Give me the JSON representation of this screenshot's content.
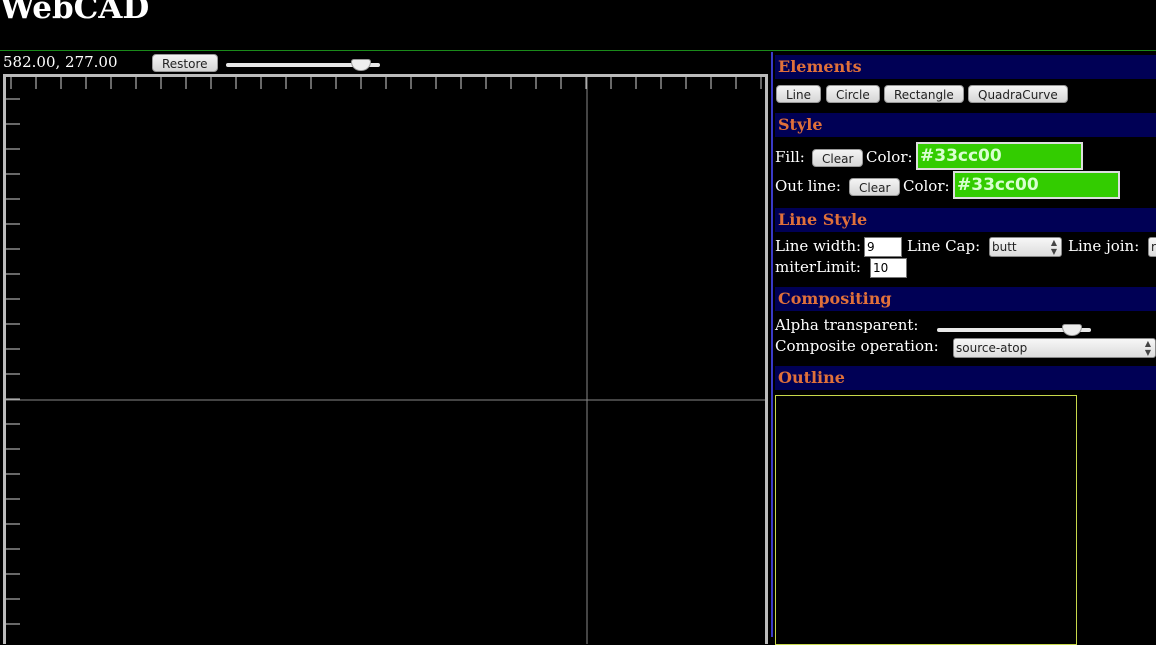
{
  "app": {
    "title": "WebCAD"
  },
  "toolbar": {
    "coordinates": "582.00, 277.00",
    "restore_label": "Restore",
    "zoom_level": 0.93
  },
  "panel": {
    "elements": {
      "header": "Elements",
      "buttons": [
        "Line",
        "Circle",
        "Rectangle",
        "QuadraCurve"
      ]
    },
    "style": {
      "header": "Style",
      "fill_label": "Fill:",
      "fill_clear": "Clear",
      "fill_color_label": "Color:",
      "fill_color_value": "#33cc00",
      "outline_label": "Out line:",
      "outline_clear": "Clear",
      "outline_color_label": "Color:",
      "outline_color_value": "#33cc00"
    },
    "line_style": {
      "header": "Line Style",
      "line_width_label": "Line width:",
      "line_width_value": "9",
      "line_cap_label": "Line Cap:",
      "line_cap_value": "butt",
      "line_join_label": "Line join:",
      "line_join_value": "r",
      "miter_limit_label": "miterLimit:",
      "miter_limit_value": "10"
    },
    "compositing": {
      "header": "Compositing",
      "alpha_label": "Alpha transparent:",
      "alpha_value": 0.93,
      "composite_label": "Composite operation:",
      "composite_value": "source-atop"
    },
    "outline": {
      "header": "Outline"
    }
  },
  "colors": {
    "background": "#000000",
    "section_header_bg": "#000055",
    "section_header_text": "#e0703a",
    "color_swatch": "#33cc00",
    "divider": "#3a3ac8",
    "outline_border": "#c8d84a"
  }
}
